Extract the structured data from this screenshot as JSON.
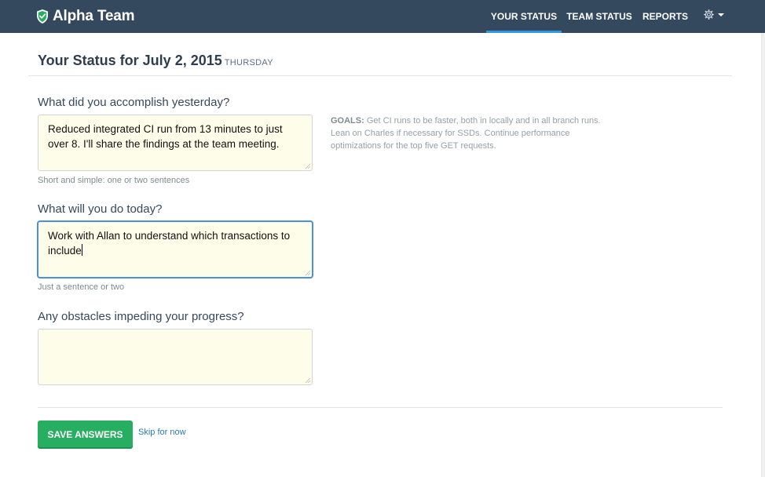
{
  "navbar": {
    "brand": "Alpha Team",
    "logo_icon": "shield-check-icon",
    "items": [
      {
        "label": "YOUR STATUS",
        "active": true
      },
      {
        "label": "TEAM STATUS",
        "active": false
      },
      {
        "label": "REPORTS",
        "active": false
      }
    ],
    "settings_icon": "gear-icon",
    "accent_color": "#3498db",
    "bg_color": "#34495e"
  },
  "page": {
    "title": "Your Status for July 2, 2015",
    "day": "THURSDAY"
  },
  "questions": [
    {
      "label": "What did you accomplish yesterday?",
      "answer": "Reduced integrated CI run from 13 minutes to just over 8. I'll share the findings at the team meeting.",
      "hint": "Short and simple: one or two sentences"
    },
    {
      "label": "What will you do today?",
      "answer": "Work with Allan to understand which transactions to include",
      "hint": "Just a sentence or two"
    },
    {
      "label": "Any obstacles impeding your progress?",
      "answer": "",
      "hint": ""
    }
  ],
  "goals": {
    "label": "GOALS:",
    "text": "Get CI runs to be faster, both in locally and in all branch runs. Lean on Charles if necessary for SSDs. Continue performance optimizations for the top five GET requests."
  },
  "actions": {
    "save_label": "SAVE ANSWERS",
    "skip_label": "Skip for now",
    "save_color": "#27ae60"
  }
}
